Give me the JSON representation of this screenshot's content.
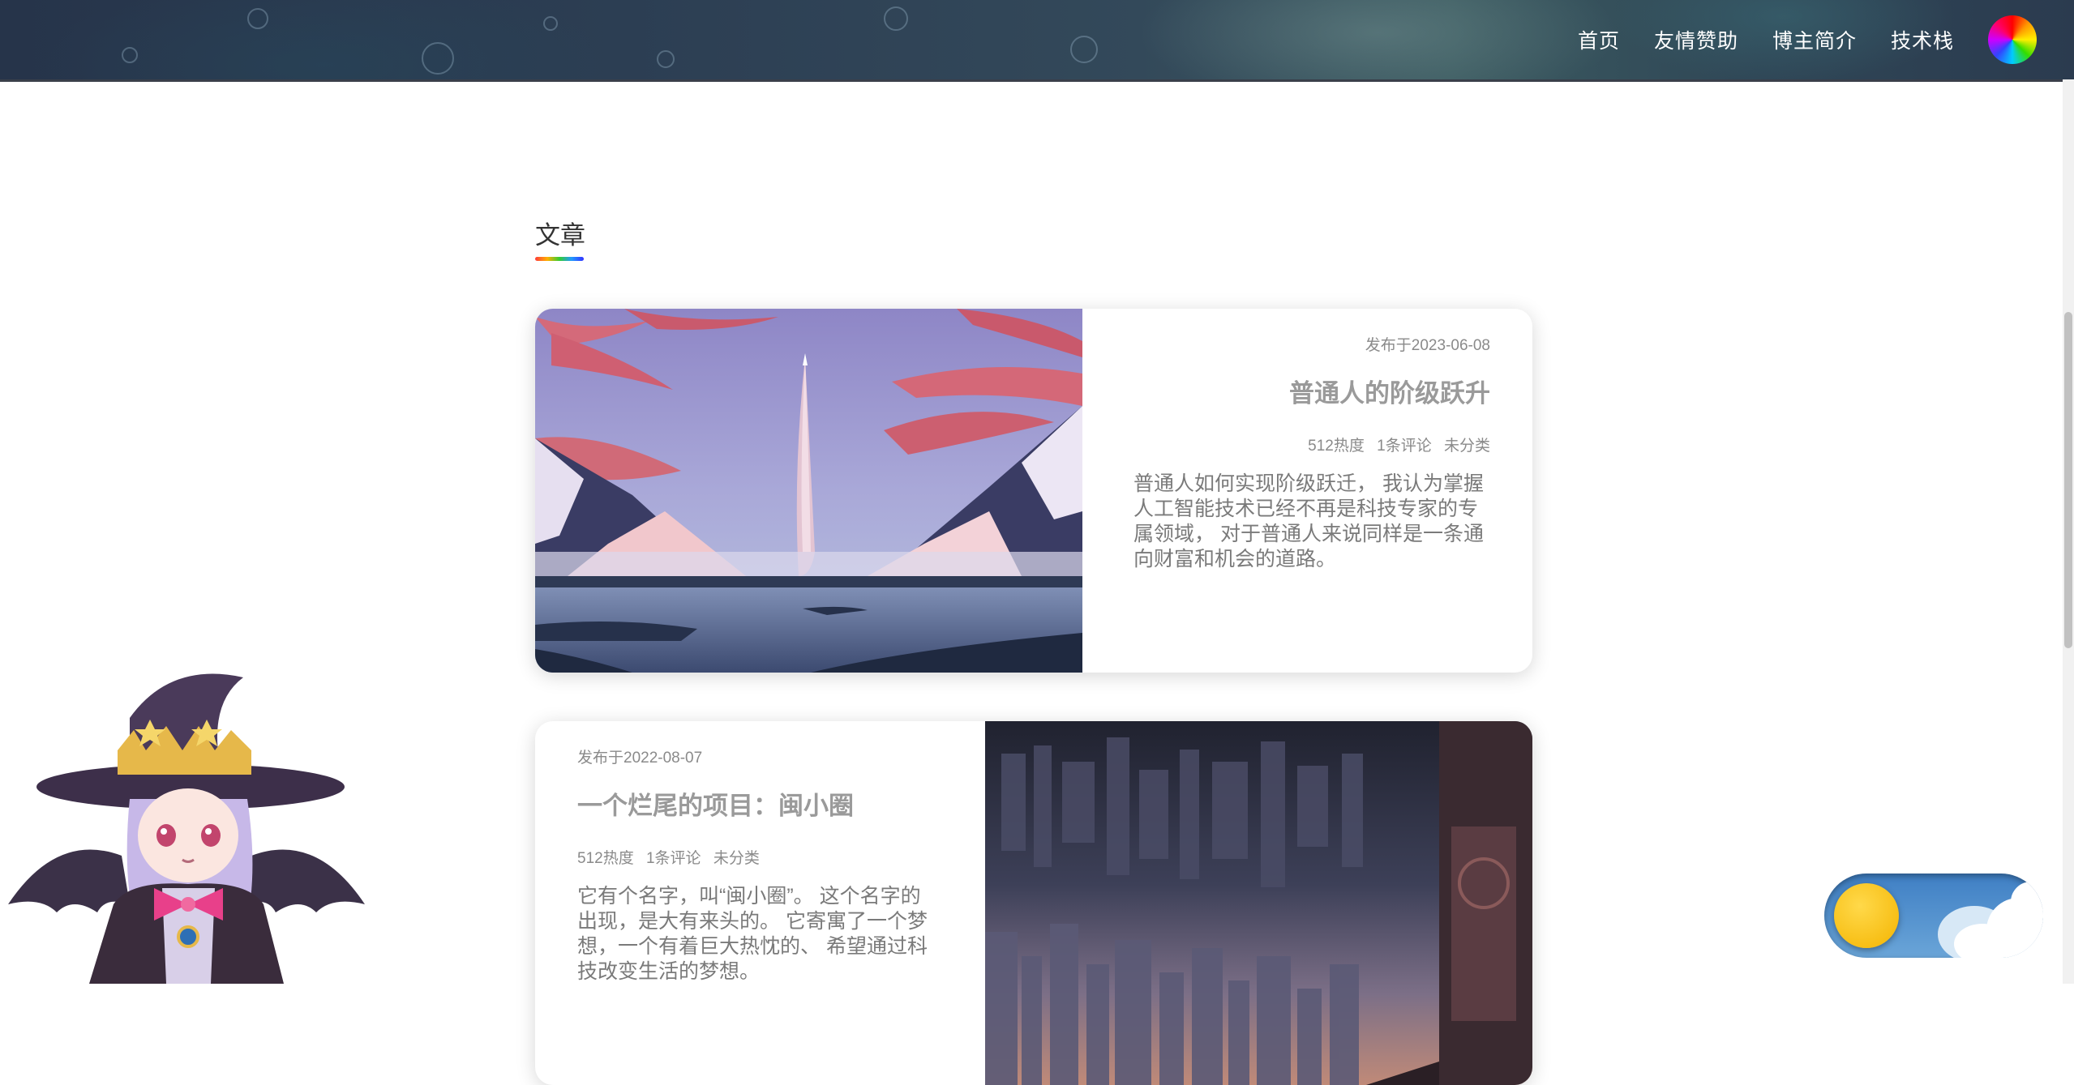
{
  "header": {
    "nav": [
      {
        "label": "首页"
      },
      {
        "label": "友情赞助"
      },
      {
        "label": "博主简介"
      },
      {
        "label": "技术栈"
      }
    ],
    "avatar_icon": "rainbow-avatar-icon"
  },
  "section": {
    "title": "文章"
  },
  "articles": [
    {
      "date": "发布于2023-06-08",
      "title": "普通人的阶级跃升",
      "views": "512热度",
      "comments": "1条评论",
      "category": "未分类",
      "summary": "普通人如何实现阶级跃迁， 我认为掌握人工智能技术已经不再是科技专家的专属领域， 对于普通人来说同样是一条通向财富和机会的道路。",
      "image_icon": "rocket-launch-landscape-image"
    },
    {
      "date": "发布于2022-08-07",
      "title": "一个烂尾的项目：闽小圈",
      "views": "512热度",
      "comments": "1条评论",
      "category": "未分类",
      "summary": "它有个名字，叫“闽小圈”。 这个名字的出现，是大有来头的。 它寄寓了一个梦想，一个有着巨大热忱的、 希望通过科技改变生活的梦想。",
      "image_icon": "city-night-image"
    }
  ],
  "theme_toggle": {
    "state": "day",
    "icon": "sun-icon"
  },
  "colors": {
    "header_bg": "#2c3e53",
    "title_gray": "#9a9a9a",
    "toggle_blue": "#4a8bcf",
    "sun_yellow": "#f8c31c"
  }
}
